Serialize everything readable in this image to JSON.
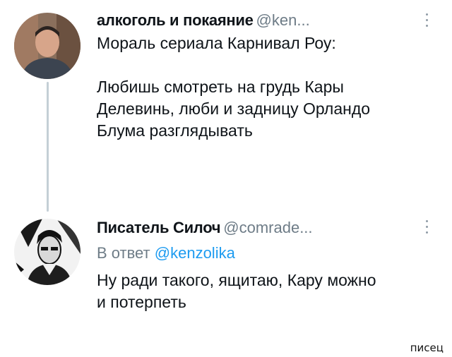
{
  "tweets": [
    {
      "author_name": "алкоголь и покаяние",
      "author_handle": "@ken...",
      "avatar_icon": "person-photo-avatar",
      "text": "Мораль сериала Карнивал Роу:\n\nЛюбишь смотреть на грудь Кары\nДелевинь, люби и задницу Орландо\nБлума разглядывать"
    },
    {
      "author_name": "Писатель Силоч",
      "author_handle": "@comrade...",
      "avatar_icon": "comic-drawing-avatar",
      "reply_prefix": "В ответ",
      "reply_handle": "@kenzolika",
      "text": "Ну ради такого, ящитаю, Кару можно\nи потерпеть"
    }
  ],
  "more_icon": "more-options-icon",
  "watermark": "писец",
  "colors": {
    "text": "#0f1419",
    "muted": "#6e7c87",
    "link": "#1d9bf0",
    "thread_line": "#c4cfd6"
  }
}
